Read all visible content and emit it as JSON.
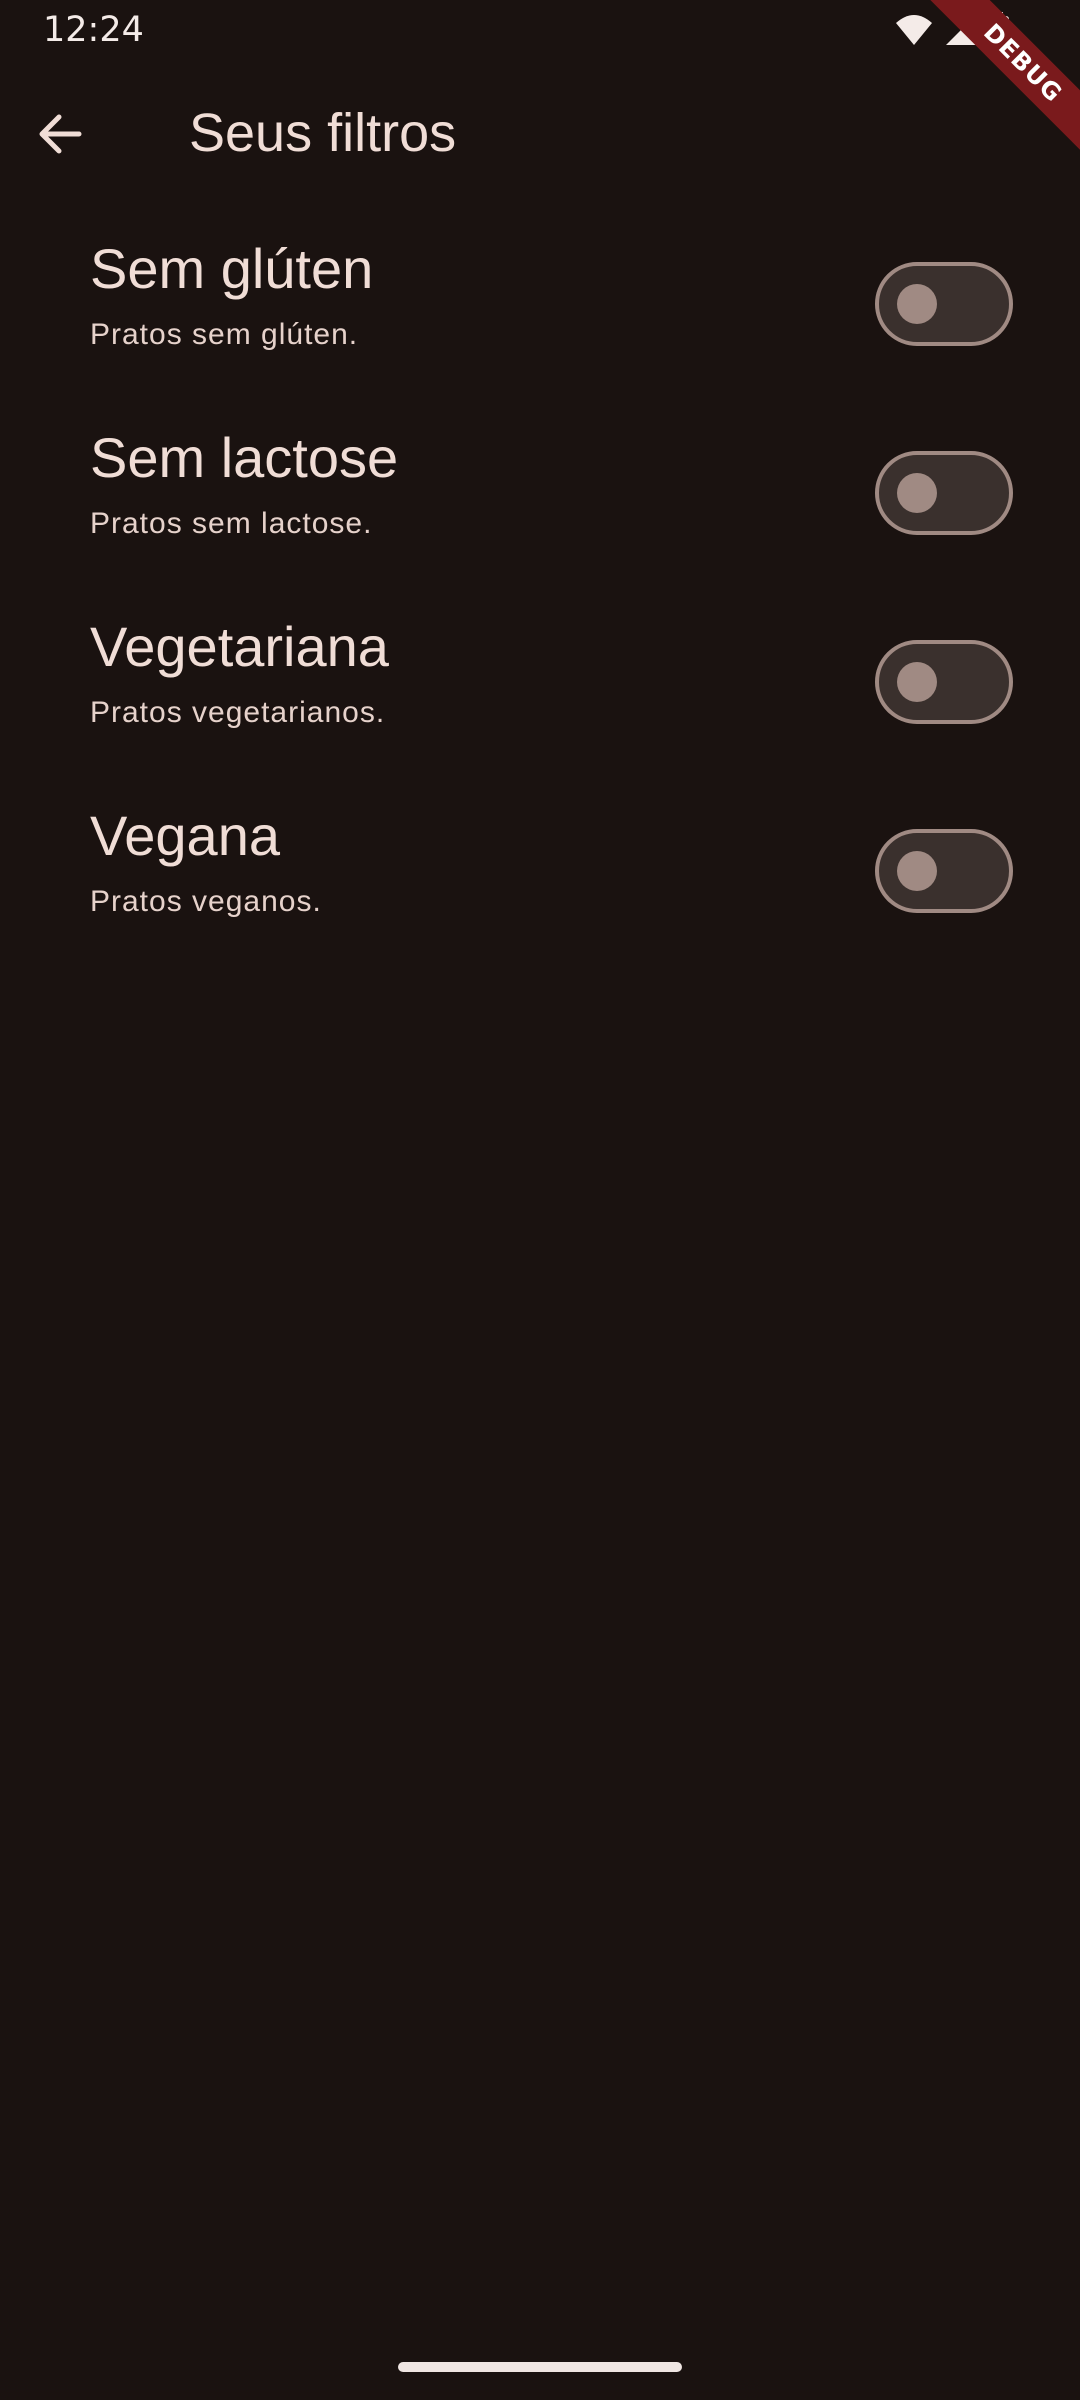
{
  "status_bar": {
    "time": "12:24",
    "icons": [
      "wifi-icon",
      "signal-icon",
      "battery-icon"
    ],
    "debug_label": "DEBUG"
  },
  "app_bar": {
    "back_icon": "arrow-back-icon",
    "title": "Seus filtros"
  },
  "filters": [
    {
      "title": "Sem glúten",
      "subtitle": "Pratos sem glúten.",
      "enabled": false
    },
    {
      "title": "Sem lactose",
      "subtitle": "Pratos sem lactose.",
      "enabled": false
    },
    {
      "title": "Vegetariana",
      "subtitle": "Pratos vegetarianos.",
      "enabled": false
    },
    {
      "title": "Vegana",
      "subtitle": "Pratos veganos.",
      "enabled": false
    }
  ],
  "colors": {
    "background": "#1a1210",
    "text": "#f0ddd6",
    "switch_track": "#3a302d",
    "switch_outline": "#a08a83",
    "debug_ribbon": "#7a1a1c"
  }
}
